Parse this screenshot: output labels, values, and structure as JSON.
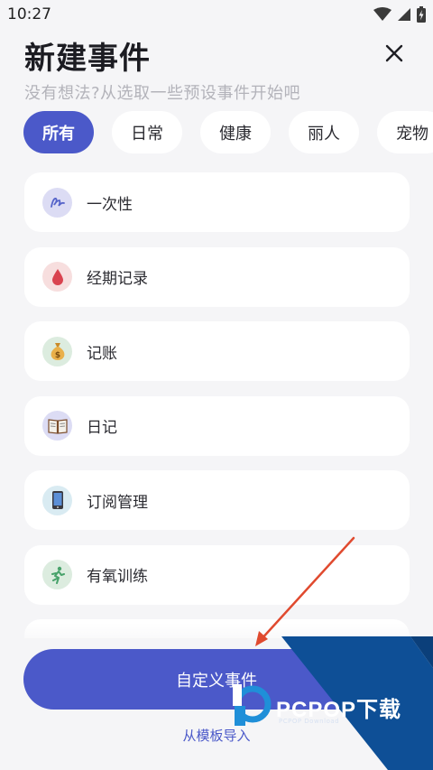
{
  "status_bar": {
    "time": "10:27"
  },
  "header": {
    "title": "新建事件",
    "subtitle": "没有想法?从选取一些预设事件开始吧"
  },
  "tabs": [
    {
      "label": "所有",
      "active": true
    },
    {
      "label": "日常",
      "active": false
    },
    {
      "label": "健康",
      "active": false
    },
    {
      "label": "丽人",
      "active": false
    },
    {
      "label": "宠物",
      "active": false
    }
  ],
  "items": [
    {
      "label": "一次性",
      "icon": "signature-icon",
      "icon_bg": "#dcdcf4"
    },
    {
      "label": "经期记录",
      "icon": "blood-drop-icon",
      "icon_bg": "#f7dede"
    },
    {
      "label": "记账",
      "icon": "money-bag-icon",
      "icon_bg": "#dcecdf"
    },
    {
      "label": "日记",
      "icon": "open-book-icon",
      "icon_bg": "#dcdcf4"
    },
    {
      "label": "订阅管理",
      "icon": "smartphone-icon",
      "icon_bg": "#d9ebf2"
    },
    {
      "label": "有氧训练",
      "icon": "runner-icon",
      "icon_bg": "#dcecdf"
    }
  ],
  "footer": {
    "custom_button": "自定义事件",
    "import_link": "从模板导入"
  },
  "watermark": {
    "text": "PCPOP下载",
    "sub": "PCPOP Download"
  },
  "colors": {
    "accent": "#4b59c9",
    "background": "#f5f5f7",
    "watermark_blue": "#0e4f96"
  }
}
